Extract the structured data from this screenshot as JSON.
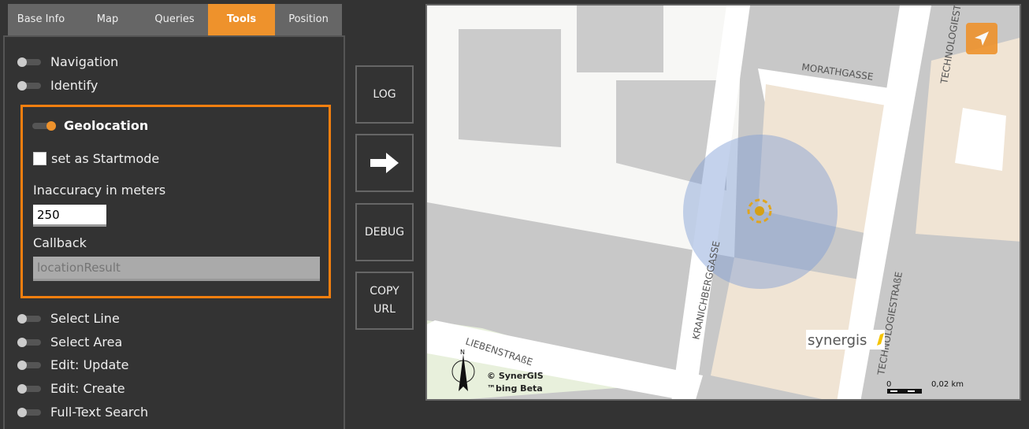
{
  "tabs": [
    {
      "label": "Base Info"
    },
    {
      "label": "Map"
    },
    {
      "label": "Queries"
    },
    {
      "label": "Tools",
      "active": true
    },
    {
      "label": "Position"
    }
  ],
  "tools": {
    "navigation": "Navigation",
    "identify": "Identify",
    "select_line": "Select Line",
    "select_area": "Select Area",
    "edit_update": "Edit: Update",
    "edit_create": "Edit: Create",
    "fulltext": "Full-Text Search"
  },
  "geolocation": {
    "title": "Geolocation",
    "enabled": true,
    "startmode_label": "set as Startmode",
    "startmode_checked": false,
    "inaccuracy_label": "Inaccuracy in meters",
    "inaccuracy_value": "250",
    "callback_label": "Callback",
    "callback_placeholder": "locationResult"
  },
  "buttons": {
    "log": "LOG",
    "arrow": "arrow-right-icon",
    "debug": "DEBUG",
    "copy_url_1": "COPY",
    "copy_url_2": "URL"
  },
  "map": {
    "streets": [
      "MORATHGASSE",
      "TECHNOLOGIESTRAßE",
      "KRANICHBERGGASSE",
      "LIEBENSTRAßE",
      "TECHNOLOGIESTRAßE"
    ],
    "north": "N",
    "copyright": "© SynerGIS",
    "bing": "™bing Beta",
    "logo": "synergis",
    "scale_start": "0",
    "scale_end": "0,02 km"
  },
  "colors": {
    "accent": "#ee922c",
    "highlight": "#f57f0f"
  }
}
